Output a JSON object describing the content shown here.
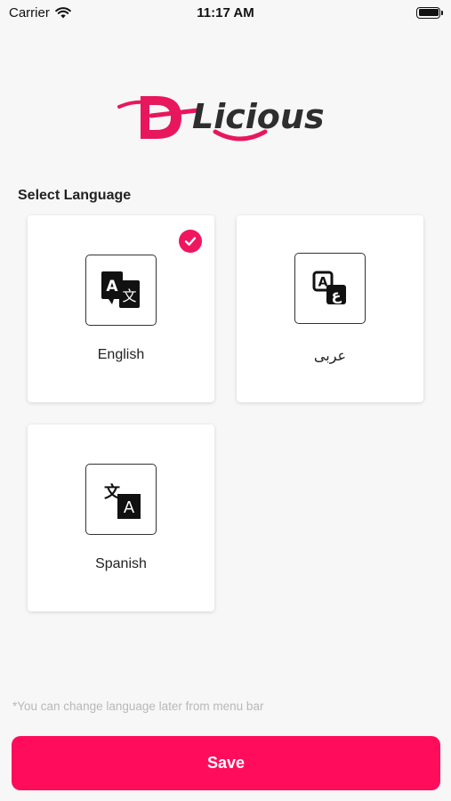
{
  "status_bar": {
    "carrier": "Carrier",
    "time": "11:17 AM"
  },
  "logo": {
    "text": "DLicious",
    "brand_color": "#e8175d",
    "dark_color": "#2e2e2e"
  },
  "section_title": "Select Language",
  "languages": [
    {
      "label": "English",
      "icon": "translate-a-icon",
      "selected": true
    },
    {
      "label": "عربى",
      "icon": "arabic-translate-icon",
      "selected": false
    },
    {
      "label": "Spanish",
      "icon": "translate-wen-a-icon",
      "selected": false
    }
  ],
  "footnote": "*You can change language later from menu bar",
  "save_label": "Save",
  "colors": {
    "accent": "#ff0d5c",
    "background": "#f7f7f7",
    "card": "#ffffff"
  }
}
